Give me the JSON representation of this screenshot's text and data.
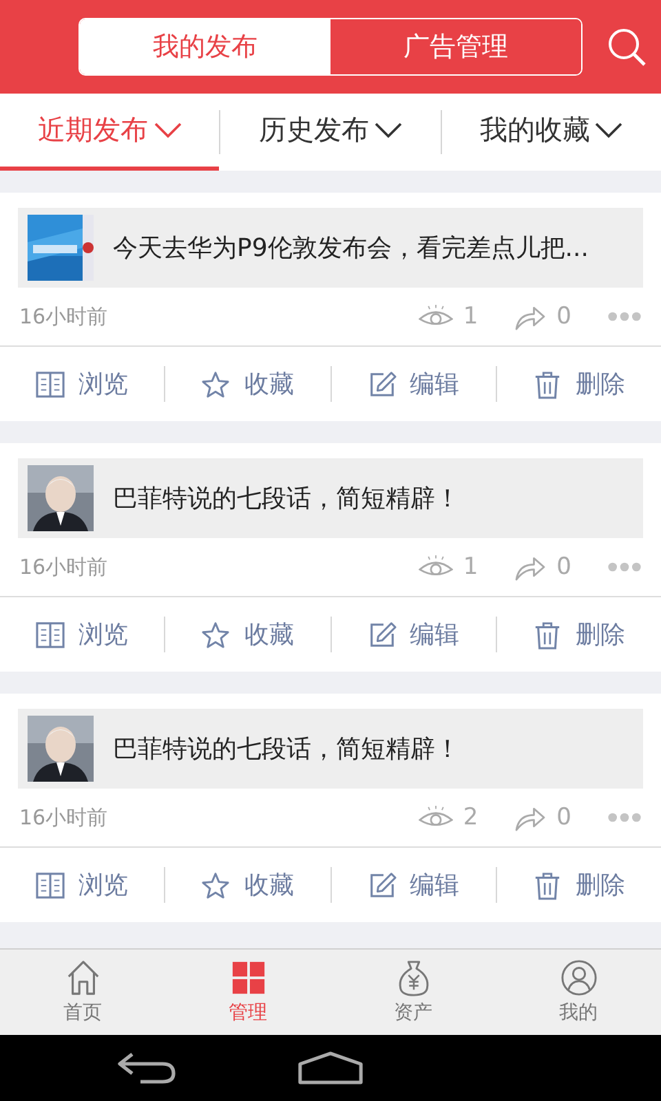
{
  "header": {
    "segments": [
      {
        "label": "我的发布",
        "selected": true
      },
      {
        "label": "广告管理",
        "selected": false
      }
    ]
  },
  "filters": [
    {
      "label": "近期发布",
      "selected": true
    },
    {
      "label": "历史发布",
      "selected": false
    },
    {
      "label": "我的收藏",
      "selected": false
    }
  ],
  "posts": [
    {
      "title": "今天去华为P9伦敦发布会，看完差点儿把...",
      "time": "16小时前",
      "views": "1",
      "shares": "0",
      "actions": [
        {
          "kind": "browse",
          "label": "浏览"
        },
        {
          "kind": "favorite",
          "label": "收藏"
        },
        {
          "kind": "edit",
          "label": "编辑"
        },
        {
          "kind": "delete",
          "label": "删除"
        }
      ]
    },
    {
      "title": "巴菲特说的七段话，简短精辟！",
      "time": "16小时前",
      "views": "1",
      "shares": "0",
      "actions": [
        {
          "kind": "browse",
          "label": "浏览"
        },
        {
          "kind": "favorite",
          "label": "收藏"
        },
        {
          "kind": "edit",
          "label": "编辑"
        },
        {
          "kind": "delete",
          "label": "删除"
        }
      ]
    },
    {
      "title": "巴菲特说的七段话，简短精辟！",
      "time": "16小时前",
      "views": "2",
      "shares": "0",
      "actions": [
        {
          "kind": "browse",
          "label": "浏览"
        },
        {
          "kind": "favorite",
          "label": "收藏"
        },
        {
          "kind": "edit",
          "label": "编辑"
        },
        {
          "kind": "delete",
          "label": "删除"
        }
      ]
    }
  ],
  "bottom_nav": [
    {
      "kind": "home",
      "label": "首页",
      "selected": false
    },
    {
      "kind": "manage",
      "label": "管理",
      "selected": true
    },
    {
      "kind": "assets",
      "label": "资产",
      "selected": false
    },
    {
      "kind": "profile",
      "label": "我的",
      "selected": false
    }
  ]
}
